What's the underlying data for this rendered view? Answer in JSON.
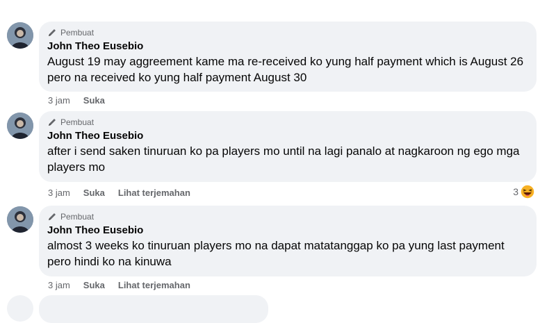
{
  "comments": [
    {
      "badge": "Pembuat",
      "author": "John Theo Eusebio",
      "text": "August 19 may aggreement kame ma re-received ko yung half payment which is August 26 pero na received ko yung half payment August 30",
      "time": "3 jam",
      "like": "Suka"
    },
    {
      "badge": "Pembuat",
      "author": "John Theo Eusebio",
      "text": "after i send saken tinuruan ko pa players mo until na lagi panalo at nagkaroon ng ego mga players mo",
      "time": "3 jam",
      "like": "Suka",
      "translate": "Lihat terjemahan",
      "reaction_count": "3"
    },
    {
      "badge": "Pembuat",
      "author": "John Theo Eusebio",
      "text": "almost 3 weeks ko tinuruan players mo na dapat matatanggap ko pa yung last payment pero hindi ko na kinuwa",
      "time": "3 jam",
      "like": "Suka",
      "translate": "Lihat terjemahan"
    }
  ],
  "icons": {
    "badge_icon": "pencil-icon",
    "reaction_icon": "haha-emoji-icon",
    "colors": {
      "bubble": "#f0f2f5",
      "meta": "#65676b",
      "haha": "#f7b125"
    }
  }
}
